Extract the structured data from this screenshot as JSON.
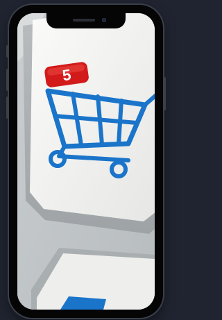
{
  "photo": {
    "subject": "shopping-cart-key",
    "badge_count": "5",
    "colors": {
      "cart_blue": "#1a74c9",
      "badge_red": "#d31a1a",
      "key_white": "#f2f2f0"
    }
  }
}
